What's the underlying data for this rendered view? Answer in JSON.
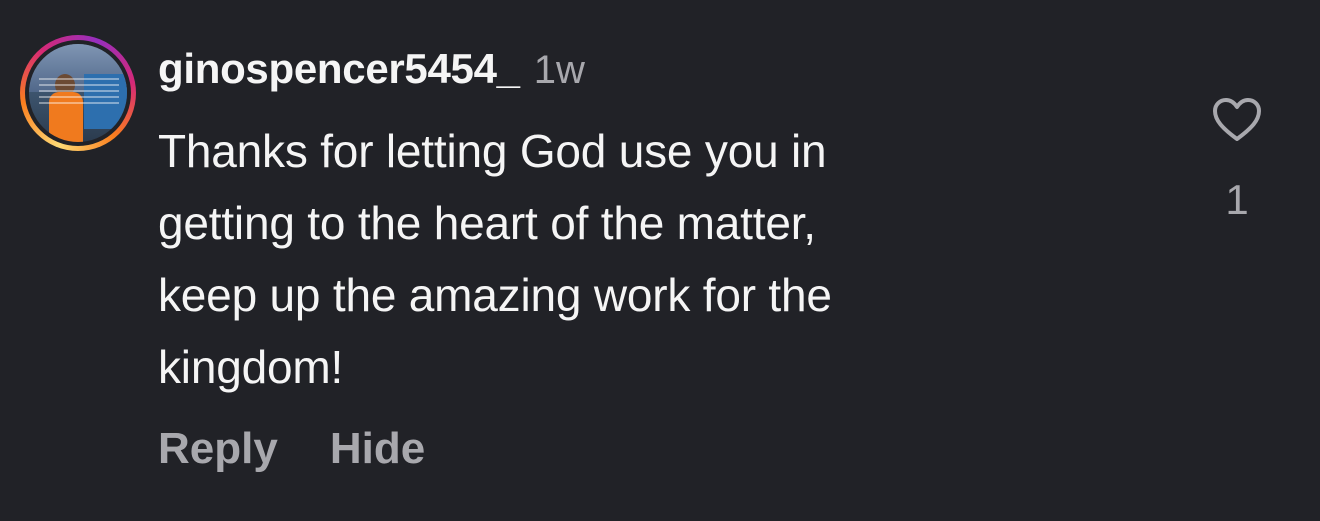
{
  "comment": {
    "username": "ginospencer5454_",
    "timestamp": "1w",
    "text_lines": [
      "Thanks for letting God use you in",
      "getting to the heart of the matter,",
      "keep up the amazing work for the",
      "kingdom!"
    ],
    "like_count": "1",
    "actions": {
      "reply_label": "Reply",
      "hide_label": "Hide"
    }
  },
  "icons": {
    "like": "heart-outline-icon",
    "avatar": "profile-photo-with-story-ring"
  },
  "colors": {
    "background": "#212227",
    "primary_text": "#f5f5f5",
    "secondary_text": "#a8a8ad",
    "story_ring": [
      "#feda75",
      "#fa7e1e",
      "#d62976",
      "#962fbf"
    ]
  }
}
